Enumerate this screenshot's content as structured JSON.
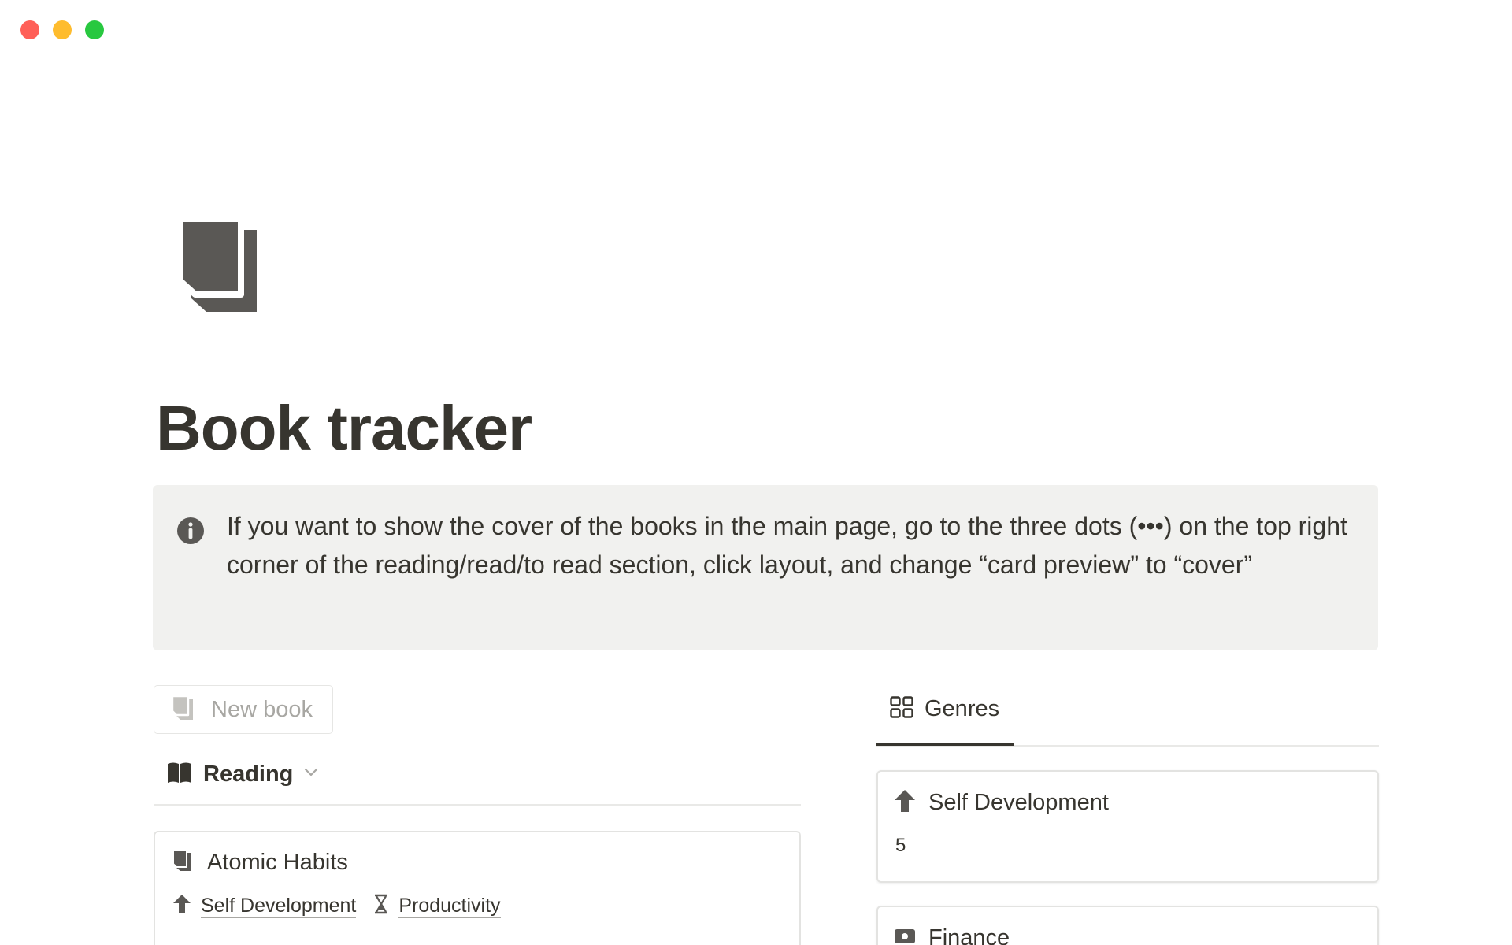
{
  "window": {
    "controls": [
      "close",
      "minimize",
      "zoom"
    ],
    "colors": {
      "close": "#ff5f57",
      "minimize": "#febc2e",
      "zoom": "#28c840"
    }
  },
  "page": {
    "icon": "book-icon",
    "title": "Book tracker"
  },
  "callout": {
    "icon": "info-icon",
    "text": "If you want to show the cover of the books in the main page, go to the three dots (•••) on the top right corner of the reading/read/to read section, click layout, and change “card preview” to “cover”"
  },
  "left_column": {
    "new_button": {
      "icon": "book-icon",
      "label": "New book"
    },
    "view": {
      "icon": "open-book-icon",
      "label": "Reading",
      "chevron": "chevron-down-icon"
    },
    "cards": [
      {
        "icon": "book-icon",
        "title": "Atomic Habits",
        "properties": [
          {
            "icon": "arrow-up-icon",
            "label": "Self Development"
          },
          {
            "icon": "hourglass-icon",
            "label": "Productivity"
          }
        ]
      }
    ]
  },
  "right_column": {
    "tab": {
      "icon": "gallery-icon",
      "label": "Genres"
    },
    "cards": [
      {
        "icon": "arrow-up-icon",
        "title": "Self Development",
        "count": "5"
      },
      {
        "icon": "finance-icon",
        "title": "Finance",
        "count": ""
      }
    ]
  },
  "colors": {
    "text": "#37352f",
    "muted": "#a8a7a3",
    "callout_bg": "#f1f1ef",
    "border": "#e3e3e1"
  }
}
